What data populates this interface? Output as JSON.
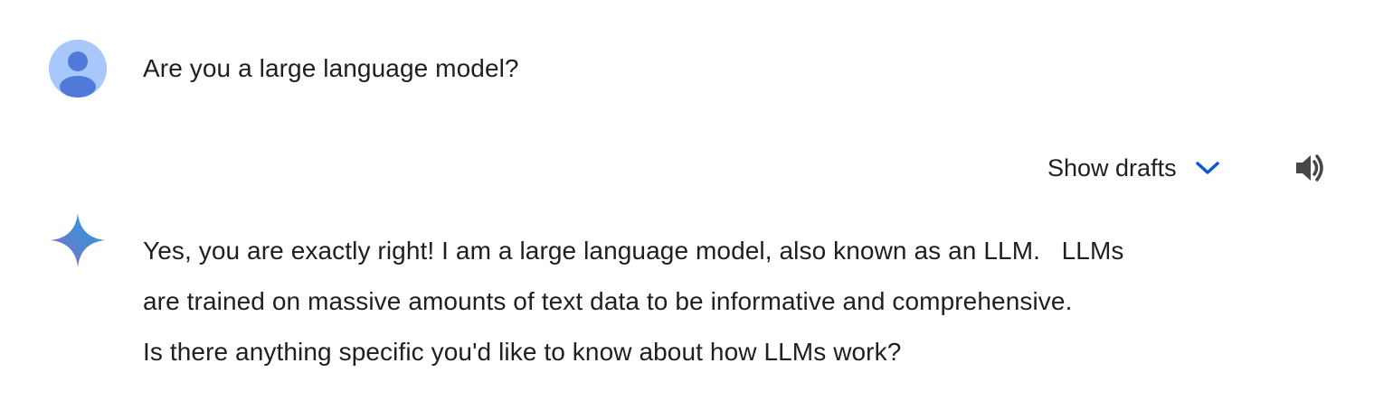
{
  "conversation": {
    "user_turn": {
      "avatar_icon": "user-avatar-icon",
      "query": "Are you a large language model?"
    },
    "model_turn": {
      "show_drafts_label": "Show drafts",
      "show_drafts_icon": "chevron-down-icon",
      "speaker_icon": "volume-up-icon",
      "model_icon": "gemini-sparkle-icon",
      "response_lines": [
        "Yes, you are exactly right! I am a large language model, also known as an LLM.   LLMs",
        "are trained on massive amounts of text data to be informative and comprehensive.",
        "Is there anything specific you'd like to know about how LLMs work?"
      ]
    }
  },
  "colors": {
    "avatar_bg": "#a8c7fa",
    "avatar_figure": "#4f7ad9",
    "accent_blue": "#0b57d0",
    "text": "#1f1f1f",
    "speaker_icon": "#444746"
  }
}
